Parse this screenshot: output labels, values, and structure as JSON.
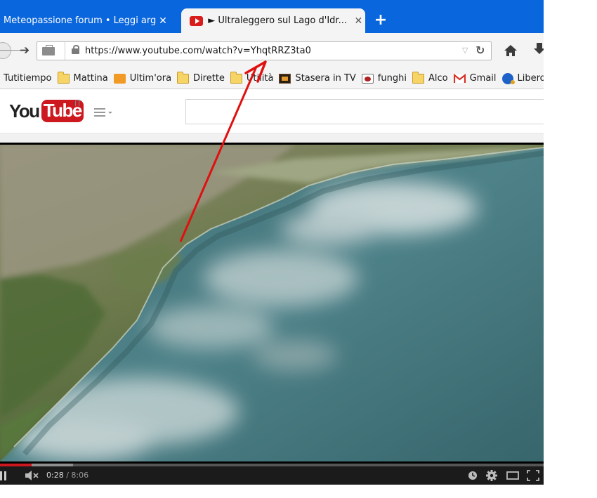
{
  "browser": {
    "tabs": [
      {
        "title": "Meteopassione forum • Leggi arg...",
        "active": false
      },
      {
        "title": "► Ultraleggero sul Lago d'Idr...",
        "active": true
      }
    ],
    "url": "https://www.youtube.com/watch?v=YhqtRRZ3ta0",
    "bookmarks": [
      {
        "label": "Tutitiempo",
        "icon": "none"
      },
      {
        "label": "Mattina",
        "icon": "folder-icon"
      },
      {
        "label": "Ultim'ora",
        "icon": "rss-icon"
      },
      {
        "label": "Dirette",
        "icon": "folder-icon"
      },
      {
        "label": "Utilità",
        "icon": "folder-icon"
      },
      {
        "label": "Stasera in TV",
        "icon": "tv-icon"
      },
      {
        "label": "funghi",
        "icon": "mushroom-icon"
      },
      {
        "label": "Alco",
        "icon": "folder-icon"
      },
      {
        "label": "Gmail",
        "icon": "gmail-icon"
      },
      {
        "label": "Libero m",
        "icon": "libero-icon"
      }
    ]
  },
  "youtube": {
    "logo_you": "You",
    "logo_tube": "Tube",
    "country": "IT",
    "search_value": ""
  },
  "player": {
    "current_time": "0:28",
    "time_separator": "/",
    "duration": "8:06",
    "played_fraction": 0.058,
    "loaded_fraction": 0.135
  },
  "colors": {
    "tabstrip": "#0a66dc",
    "youtube_red": "#cc181e",
    "annotation_arrow": "#e01010"
  }
}
